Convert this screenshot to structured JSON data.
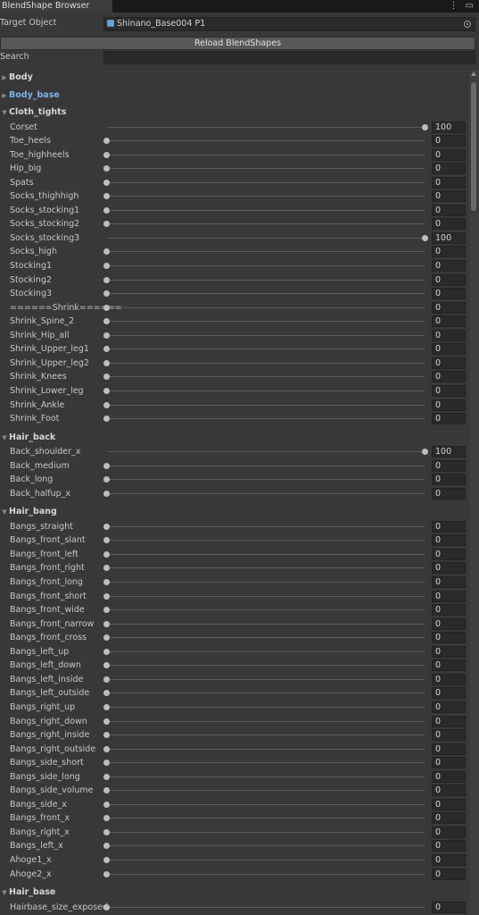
{
  "window": {
    "tab_title": "BlendShape Browser",
    "menu_icon": "kebab-icon",
    "maximize_icon": "window-icon"
  },
  "target": {
    "label": "Target Object",
    "value": "Shinano_Base004 P1",
    "icon": "mesh-cube-icon"
  },
  "reload_label": "Reload BlendShapes",
  "search": {
    "label": "Search",
    "value": ""
  },
  "groups": [
    {
      "name": "Body",
      "expanded": false,
      "highlight": false,
      "items": []
    },
    {
      "name": "Body_base",
      "expanded": false,
      "highlight": true,
      "items": []
    },
    {
      "name": "Cloth_tights",
      "expanded": true,
      "highlight": false,
      "items": [
        {
          "label": "Corset",
          "value": 100
        },
        {
          "label": "Toe_heels",
          "value": 0
        },
        {
          "label": "Toe_highheels",
          "value": 0
        },
        {
          "label": "Hip_big",
          "value": 0
        },
        {
          "label": "Spats",
          "value": 0
        },
        {
          "label": "Socks_thighhigh",
          "value": 0
        },
        {
          "label": "Socks_stocking1",
          "value": 0
        },
        {
          "label": "Socks_stocking2",
          "value": 0
        },
        {
          "label": "Socks_stocking3",
          "value": 100
        },
        {
          "label": "Socks_high",
          "value": 0
        },
        {
          "label": "Stocking1",
          "value": 0
        },
        {
          "label": "Stocking2",
          "value": 0
        },
        {
          "label": "Stocking3",
          "value": 0
        },
        {
          "label": "======Shrink======",
          "value": 0
        },
        {
          "label": "Shrink_Spine_2",
          "value": 0
        },
        {
          "label": "Shrink_Hip_all",
          "value": 0
        },
        {
          "label": "Shrink_Upper_leg1",
          "value": 0
        },
        {
          "label": "Shrink_Upper_leg2",
          "value": 0
        },
        {
          "label": "Shrink_Knees",
          "value": 0
        },
        {
          "label": "Shrink_Lower_leg",
          "value": 0
        },
        {
          "label": "Shrink_Ankle",
          "value": 0
        },
        {
          "label": "Shrink_Foot",
          "value": 0
        }
      ]
    },
    {
      "name": "Hair_back",
      "expanded": true,
      "highlight": false,
      "items": [
        {
          "label": "Back_shoulder_x",
          "value": 100
        },
        {
          "label": "Back_medium",
          "value": 0
        },
        {
          "label": "Back_long",
          "value": 0
        },
        {
          "label": "Back_halfup_x",
          "value": 0
        }
      ]
    },
    {
      "name": "Hair_bang",
      "expanded": true,
      "highlight": false,
      "items": [
        {
          "label": "Bangs_straight",
          "value": 0
        },
        {
          "label": "Bangs_front_slant",
          "value": 0
        },
        {
          "label": "Bangs_front_left",
          "value": 0
        },
        {
          "label": "Bangs_front_right",
          "value": 0
        },
        {
          "label": "Bangs_front_long",
          "value": 0
        },
        {
          "label": "Bangs_front_short",
          "value": 0
        },
        {
          "label": "Bangs_front_wide",
          "value": 0
        },
        {
          "label": "Bangs_front_narrow",
          "value": 0
        },
        {
          "label": "Bangs_front_cross",
          "value": 0
        },
        {
          "label": "Bangs_left_up",
          "value": 0
        },
        {
          "label": "Bangs_left_down",
          "value": 0
        },
        {
          "label": "Bangs_left_inside",
          "value": 0
        },
        {
          "label": "Bangs_left_outside",
          "value": 0
        },
        {
          "label": "Bangs_right_up",
          "value": 0
        },
        {
          "label": "Bangs_right_down",
          "value": 0
        },
        {
          "label": "Bangs_right_inside",
          "value": 0
        },
        {
          "label": "Bangs_right_outside",
          "value": 0
        },
        {
          "label": "Bangs_side_short",
          "value": 0
        },
        {
          "label": "Bangs_side_long",
          "value": 0
        },
        {
          "label": "Bangs_side_volume",
          "value": 0
        },
        {
          "label": "Bangs_side_x",
          "value": 0
        },
        {
          "label": "Bangs_front_x",
          "value": 0
        },
        {
          "label": "Bangs_right_x",
          "value": 0
        },
        {
          "label": "Bangs_left_x",
          "value": 0
        },
        {
          "label": "Ahoge1_x",
          "value": 0
        },
        {
          "label": "Ahoge2_x",
          "value": 0
        }
      ]
    },
    {
      "name": "Hair_base",
      "expanded": true,
      "highlight": false,
      "items": [
        {
          "label": "Hairbase_size_exposed",
          "value": 0
        }
      ]
    }
  ]
}
